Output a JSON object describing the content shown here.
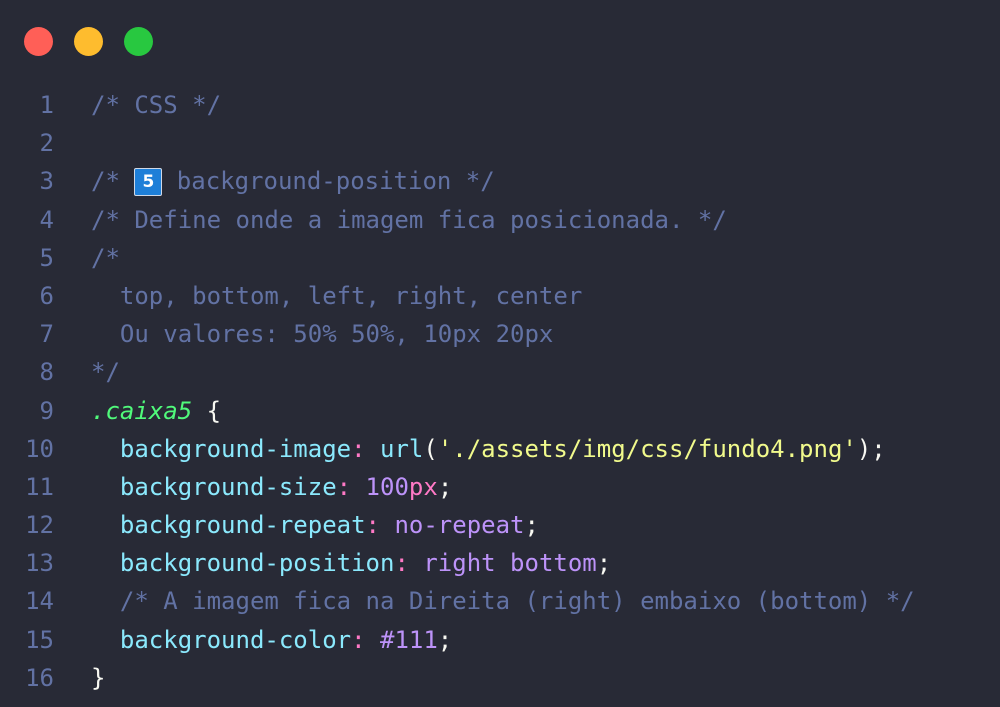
{
  "window": {
    "controls": [
      {
        "name": "close",
        "color": "#ff5f57"
      },
      {
        "name": "minimize",
        "color": "#febc2e"
      },
      {
        "name": "maximize",
        "color": "#28c840"
      }
    ]
  },
  "colors": {
    "background": "#282a36",
    "comment": "#6272a4",
    "selector": "#50fa7b",
    "property": "#8be9fd",
    "string": "#f1fa8c",
    "number": "#bd93f9",
    "keyword": "#ff79c6"
  },
  "lines": [
    {
      "n": "1",
      "tokens": [
        {
          "t": "/* CSS */",
          "c": "comment"
        }
      ]
    },
    {
      "n": "2",
      "tokens": []
    },
    {
      "n": "3",
      "tokens": [
        {
          "t": "/* ",
          "c": "comment"
        },
        {
          "t": "5",
          "c": "badge"
        },
        {
          "t": " background-position */",
          "c": "comment"
        }
      ]
    },
    {
      "n": "4",
      "tokens": [
        {
          "t": "/* Define onde a imagem fica posicionada. */",
          "c": "comment"
        }
      ]
    },
    {
      "n": "5",
      "tokens": [
        {
          "t": "/*",
          "c": "comment"
        }
      ]
    },
    {
      "n": "6",
      "tokens": [
        {
          "t": "  top, bottom, left, right, center",
          "c": "comment"
        }
      ]
    },
    {
      "n": "7",
      "tokens": [
        {
          "t": "  Ou valores: 50% 50%, 10px 20px",
          "c": "comment"
        }
      ]
    },
    {
      "n": "8",
      "tokens": [
        {
          "t": "*/",
          "c": "comment"
        }
      ]
    },
    {
      "n": "9",
      "tokens": [
        {
          "t": ".caixa5",
          "c": "selector"
        },
        {
          "t": " {",
          "c": "plain"
        }
      ]
    },
    {
      "n": "10",
      "tokens": [
        {
          "t": "  background-image",
          "c": "prop"
        },
        {
          "t": ":",
          "c": "punct"
        },
        {
          "t": " ",
          "c": "plain"
        },
        {
          "t": "url",
          "c": "func"
        },
        {
          "t": "(",
          "c": "plain"
        },
        {
          "t": "'./assets/img/css/fundo4.png'",
          "c": "str"
        },
        {
          "t": ");",
          "c": "plain"
        }
      ]
    },
    {
      "n": "11",
      "tokens": [
        {
          "t": "  background-size",
          "c": "prop"
        },
        {
          "t": ":",
          "c": "punct"
        },
        {
          "t": " ",
          "c": "plain"
        },
        {
          "t": "100",
          "c": "num"
        },
        {
          "t": "px",
          "c": "unit"
        },
        {
          "t": ";",
          "c": "plain"
        }
      ]
    },
    {
      "n": "12",
      "tokens": [
        {
          "t": "  background-repeat",
          "c": "prop"
        },
        {
          "t": ":",
          "c": "punct"
        },
        {
          "t": " ",
          "c": "plain"
        },
        {
          "t": "no-repeat",
          "c": "kw"
        },
        {
          "t": ";",
          "c": "plain"
        }
      ]
    },
    {
      "n": "13",
      "tokens": [
        {
          "t": "  background-position",
          "c": "prop"
        },
        {
          "t": ":",
          "c": "punct"
        },
        {
          "t": " ",
          "c": "plain"
        },
        {
          "t": "right bottom",
          "c": "kw"
        },
        {
          "t": ";",
          "c": "plain"
        }
      ]
    },
    {
      "n": "14",
      "tokens": [
        {
          "t": "  /* A imagem fica na Direita (right) embaixo (bottom) */",
          "c": "comment"
        }
      ]
    },
    {
      "n": "15",
      "tokens": [
        {
          "t": "  background-color",
          "c": "prop"
        },
        {
          "t": ":",
          "c": "punct"
        },
        {
          "t": " ",
          "c": "plain"
        },
        {
          "t": "#111",
          "c": "kw"
        },
        {
          "t": ";",
          "c": "plain"
        }
      ]
    },
    {
      "n": "16",
      "tokens": [
        {
          "t": "}",
          "c": "plain"
        }
      ]
    }
  ]
}
